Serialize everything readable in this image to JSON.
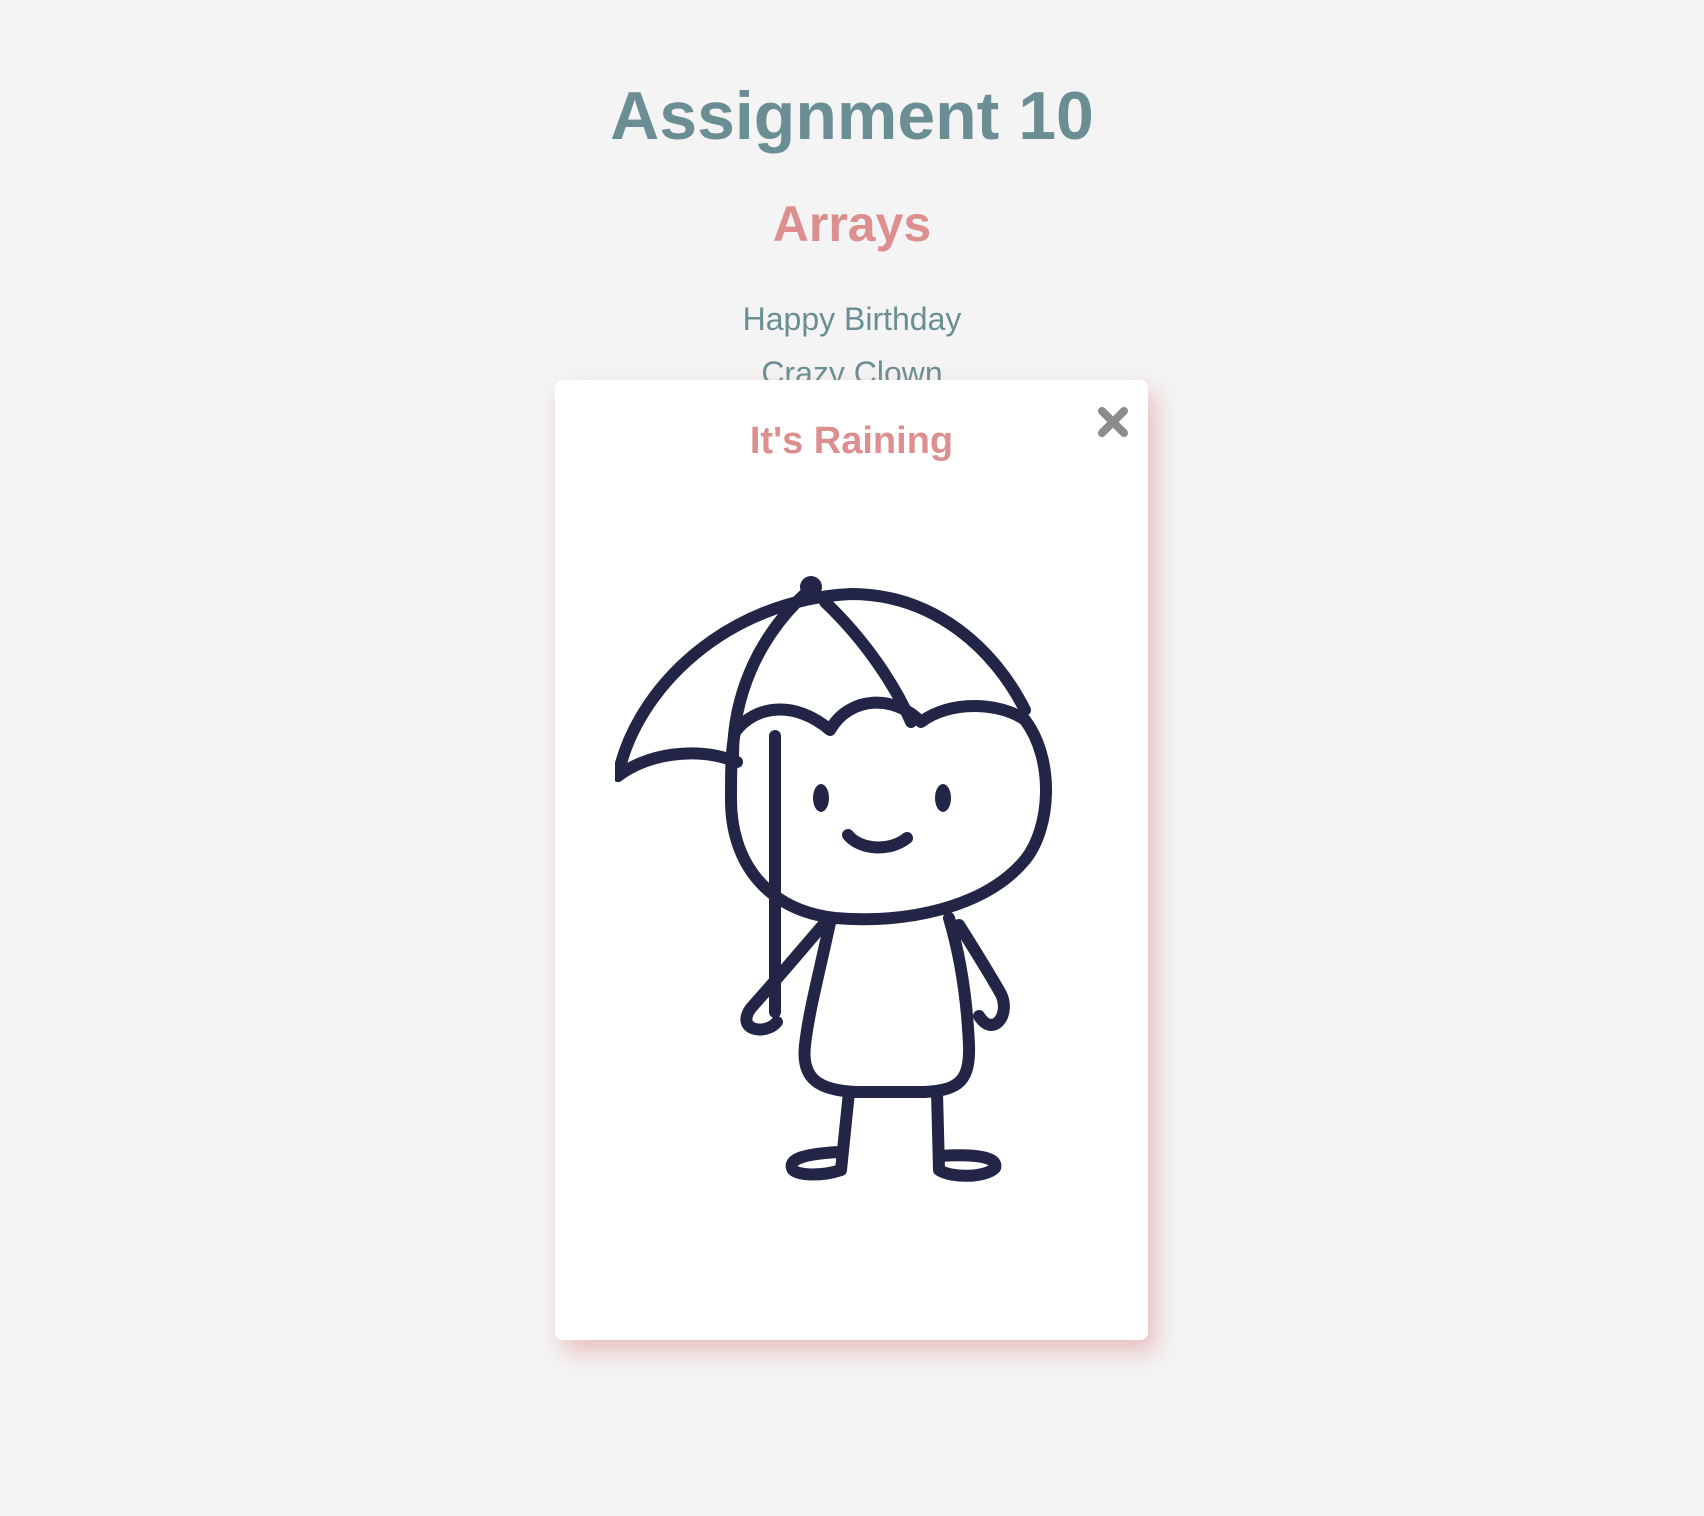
{
  "page": {
    "title": "Assignment 10",
    "subtitle": "Arrays"
  },
  "array_items": [
    "Happy Birthday",
    "Crazy Clown"
  ],
  "modal": {
    "title": "It's Raining",
    "close_icon": "close-x-icon",
    "image_icon": "umbrella-person-drawing"
  },
  "colors": {
    "background": "#f4f4f4",
    "title": "#6b8e94",
    "accent": "#dd8f8f",
    "list_text": "#6b8e94",
    "modal_bg": "#ffffff",
    "close_icon": "#8c8c8c",
    "drawing_stroke": "#232546"
  }
}
